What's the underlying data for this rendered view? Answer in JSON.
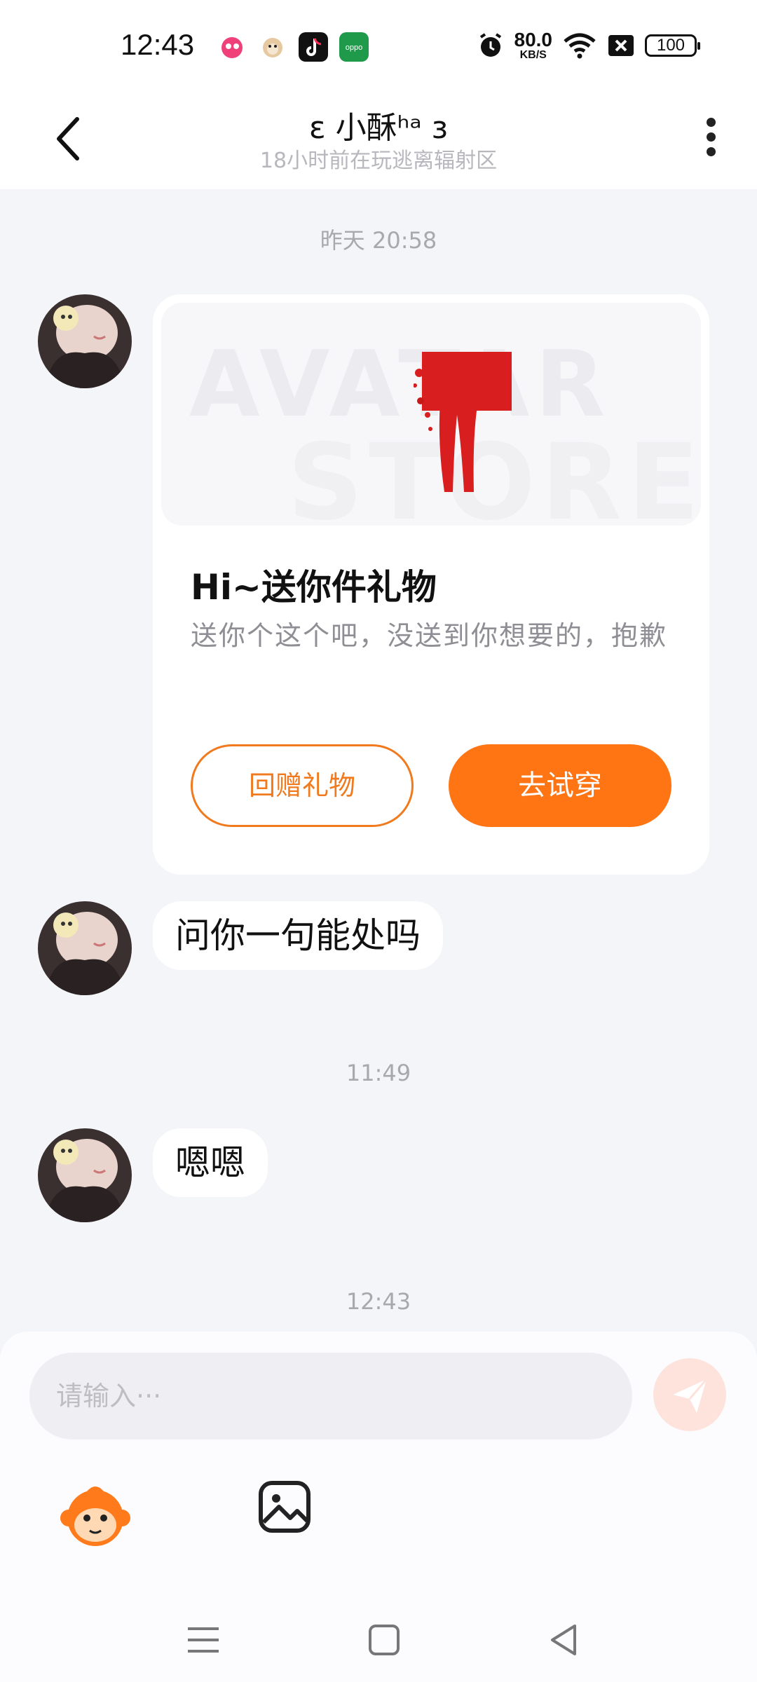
{
  "status_bar": {
    "time": "12:43",
    "net_speed_value": "80.0",
    "net_speed_unit": "KB/S",
    "battery": "100",
    "icons": [
      "app-icon-pink",
      "app-icon-monkey",
      "tiktok-icon",
      "oppo-store-icon",
      "alarm-icon",
      "wifi-icon",
      "sim-off-icon",
      "battery-icon"
    ]
  },
  "header": {
    "title": "ε 小酥ʰᵃ з",
    "subtitle": "18小时前在玩逃离辐射区"
  },
  "messages": [
    {
      "timestamp": "昨天 20:58",
      "type": "gift",
      "gift": {
        "watermark_top": "AVATAR",
        "watermark_bottom": "STORE",
        "title": "Hi~送你件礼物",
        "description": "送你个这个吧，没送到你想要的，抱歉",
        "return_label": "回赠礼物",
        "try_label": "去试穿"
      }
    },
    {
      "type": "text",
      "text": "问你一句能处吗"
    },
    {
      "timestamp": "11:49",
      "type": "text",
      "text": "嗯嗯"
    },
    {
      "timestamp": "12:43"
    }
  ],
  "input": {
    "placeholder": "请输入···"
  },
  "colors": {
    "accent": "#ff7413",
    "background": "#f4f5f9",
    "bubble": "#ffffff"
  }
}
